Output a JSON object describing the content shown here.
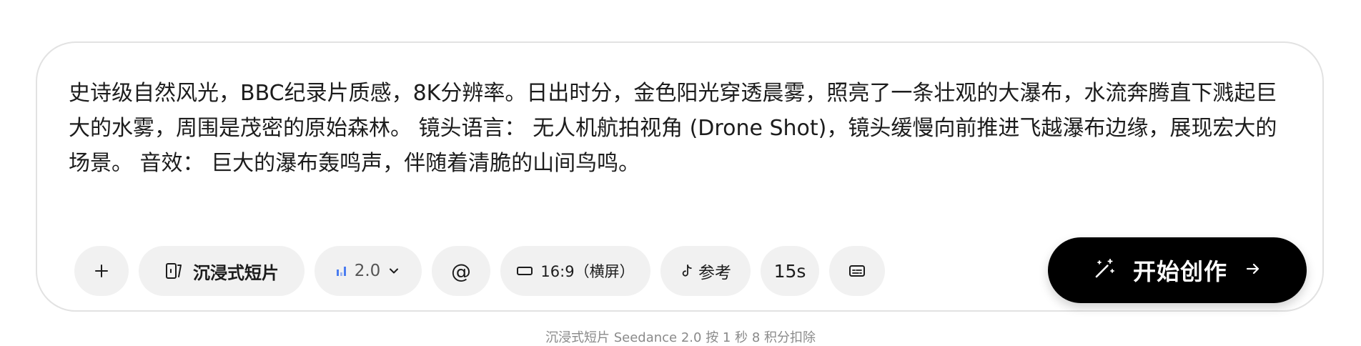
{
  "prompt": {
    "text": "史诗级自然风光，BBC纪录片质感，8K分辨率。日出时分，金色阳光穿透晨雾，照亮了一条壮观的大瀑布，水流奔腾直下溅起巨大的水雾，周围是茂密的原始森林。 镜头语言： 无人机航拍视角 (Drone Shot)，镜头缓慢向前推进飞越瀑布边缘，展现宏大的场景。 音效： 巨大的瀑布轰鸣声，伴随着清脆的山间鸟鸣。"
  },
  "toolbar": {
    "add_icon": "plus-icon",
    "mode": {
      "icon": "immersive-video-icon",
      "label": "沉浸式短片"
    },
    "model": {
      "icon": "bar-chart-icon",
      "label": "2.0",
      "chevron": "chevron-down-icon"
    },
    "mention": {
      "label": "@"
    },
    "ratio": {
      "icon": "landscape-rect-icon",
      "label": "16:9（横屏）"
    },
    "reference": {
      "icon": "tiktok-icon",
      "label": "参考"
    },
    "duration": {
      "label": "15s"
    },
    "subtitles": {
      "icon": "subtitles-icon"
    }
  },
  "create_button": {
    "icon": "magic-wand-icon",
    "label": "开始创作",
    "arrow": "arrow-right-icon"
  },
  "footnote": "沉浸式短片 Seedance 2.0 按 1 秒 8 积分扣除",
  "colors": {
    "button_bg": "#000000",
    "pill_bg": "#f1f1f1",
    "model_accent": "#4a7cf0",
    "border": "#e2e2e2",
    "footnote": "#8a8a8a"
  }
}
